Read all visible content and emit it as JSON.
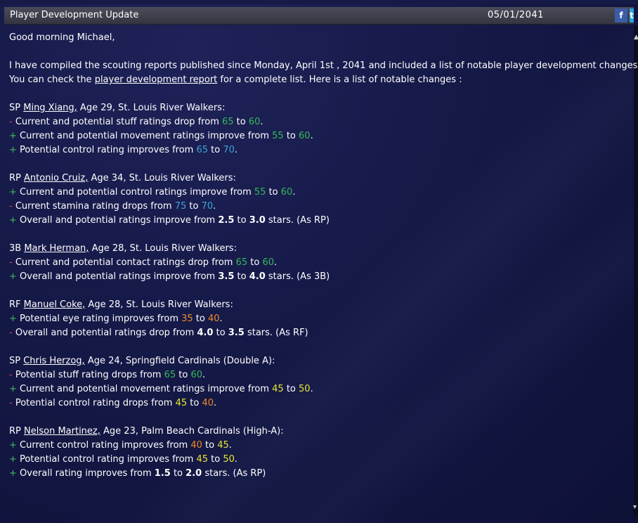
{
  "header": {
    "title": "Player Development Update",
    "date": "05/01/2041",
    "facebook_label": "f",
    "twitter_label": "t"
  },
  "colors": {
    "background": "#151947",
    "title_bar": "#3e3f4b",
    "minus_sign": "#e84747",
    "plus_sign": "#3fba5d",
    "green_value": "#36b85a",
    "blue_value": "#3ea3d8",
    "orange_value": "#f08a24",
    "yellow_value": "#e8e634"
  },
  "body": {
    "greeting": "Good morning Michael,",
    "intro_line1": "I have compiled the scouting reports published since Monday, April 1st , 2041 and included a list of notable player development changes.",
    "intro_line2_prefix": "You can check the ",
    "intro_link": "player development report",
    "intro_line2_suffix": " for a complete list. Here is a list of notable changes :"
  },
  "players": [
    {
      "pos": "SP",
      "name": "Ming Xiang,",
      "info": " Age 29, St. Louis River Walkers:",
      "changes": [
        {
          "sign": "-",
          "text": " Current and potential stuff ratings drop from ",
          "from": "65",
          "mid": " to ",
          "to": "60",
          "end": "."
        },
        {
          "sign": "+",
          "text": " Current and potential movement ratings improve from ",
          "from": "55",
          "mid": " to ",
          "to": "60",
          "end": "."
        },
        {
          "sign": "+",
          "text": " Potential control rating improves from ",
          "from": "65",
          "mid": " to ",
          "to": "70",
          "end": "."
        }
      ]
    },
    {
      "pos": "RP",
      "name": "Antonio Cruiz,",
      "info": " Age 34, St. Louis River Walkers:",
      "changes": [
        {
          "sign": "+",
          "text": " Current and potential control ratings improve from ",
          "from": "55",
          "mid": " to ",
          "to": "60",
          "end": "."
        },
        {
          "sign": "-",
          "text": " Current stamina rating drops from ",
          "from": "75",
          "mid": " to ",
          "to": "70",
          "end": "."
        },
        {
          "sign": "+",
          "text": " Overall and potential ratings improve from ",
          "from": "2.5",
          "mid": " to ",
          "to": "3.0",
          "end": " stars. (As RP)"
        }
      ]
    },
    {
      "pos": "3B",
      "name": "Mark Herman,",
      "info": " Age 28, St. Louis River Walkers:",
      "changes": [
        {
          "sign": "-",
          "text": " Current and potential contact ratings drop from ",
          "from": "65",
          "mid": " to ",
          "to": "60",
          "end": "."
        },
        {
          "sign": "+",
          "text": " Overall and potential ratings improve from ",
          "from": "3.5",
          "mid": " to ",
          "to": "4.0",
          "end": " stars. (As 3B)"
        }
      ]
    },
    {
      "pos": "RF",
      "name": "Manuel Coke,",
      "info": " Age 28, St. Louis River Walkers:",
      "changes": [
        {
          "sign": "+",
          "text": " Potential eye rating improves from ",
          "from": "35",
          "mid": " to ",
          "to": "40",
          "end": "."
        },
        {
          "sign": "-",
          "text": " Overall and potential ratings drop from ",
          "from": "4.0",
          "mid": " to ",
          "to": "3.5",
          "end": " stars. (As RF)"
        }
      ]
    },
    {
      "pos": "SP",
      "name": "Chris Herzog,",
      "info": " Age 24, Springfield Cardinals (Double A):",
      "changes": [
        {
          "sign": "-",
          "text": " Potential stuff rating drops from ",
          "from": "65",
          "mid": " to ",
          "to": "60",
          "end": "."
        },
        {
          "sign": "+",
          "text": " Current and potential movement ratings improve from ",
          "from": "45",
          "mid": " to ",
          "to": "50",
          "end": "."
        },
        {
          "sign": "-",
          "text": " Potential control rating drops from ",
          "from": "45",
          "mid": " to ",
          "to": "40",
          "end": "."
        }
      ]
    },
    {
      "pos": "RP",
      "name": "Nelson Martinez,",
      "info": " Age 23, Palm Beach Cardinals (High-A):",
      "changes": [
        {
          "sign": "+",
          "text": " Current control rating improves from ",
          "from": "40",
          "mid": " to ",
          "to": "45",
          "end": "."
        },
        {
          "sign": "+",
          "text": " Potential control rating improves from ",
          "from": "45",
          "mid": " to ",
          "to": "50",
          "end": "."
        },
        {
          "sign": "+",
          "text": " Overall rating improves from ",
          "from": "1.5",
          "mid": " to ",
          "to": "2.0",
          "end": " stars. (As RP)"
        }
      ]
    }
  ]
}
